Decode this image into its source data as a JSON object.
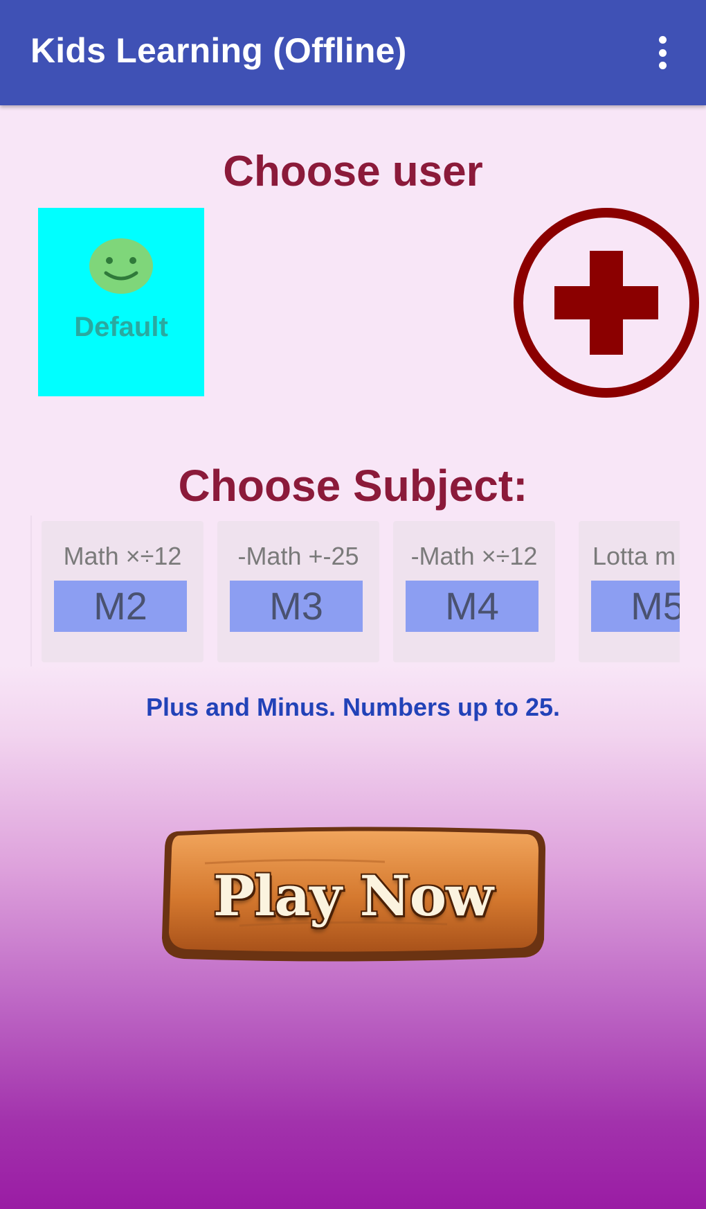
{
  "appbar": {
    "title": "Kids Learning (Offline)",
    "menu_icon": "more-vert-icon",
    "color": "#3f51b5"
  },
  "user_section": {
    "heading": "Choose user",
    "users": [
      {
        "name": "Default",
        "icon": "smiley-icon",
        "color": "#00ffff"
      }
    ],
    "add_icon": "plus-circle-icon",
    "accent": "#8b0000"
  },
  "subject_section": {
    "heading": "Choose Subject:",
    "subjects": [
      {
        "caption": "Math ×÷12",
        "code": "M2"
      },
      {
        "caption": "-Math +-25",
        "code": "M3"
      },
      {
        "caption": "-Math ×÷12",
        "code": "M4"
      },
      {
        "caption": "Lotta m",
        "code": "M5"
      }
    ],
    "description": "Plus and Minus. Numbers up to 25."
  },
  "play": {
    "label": "Play Now"
  }
}
